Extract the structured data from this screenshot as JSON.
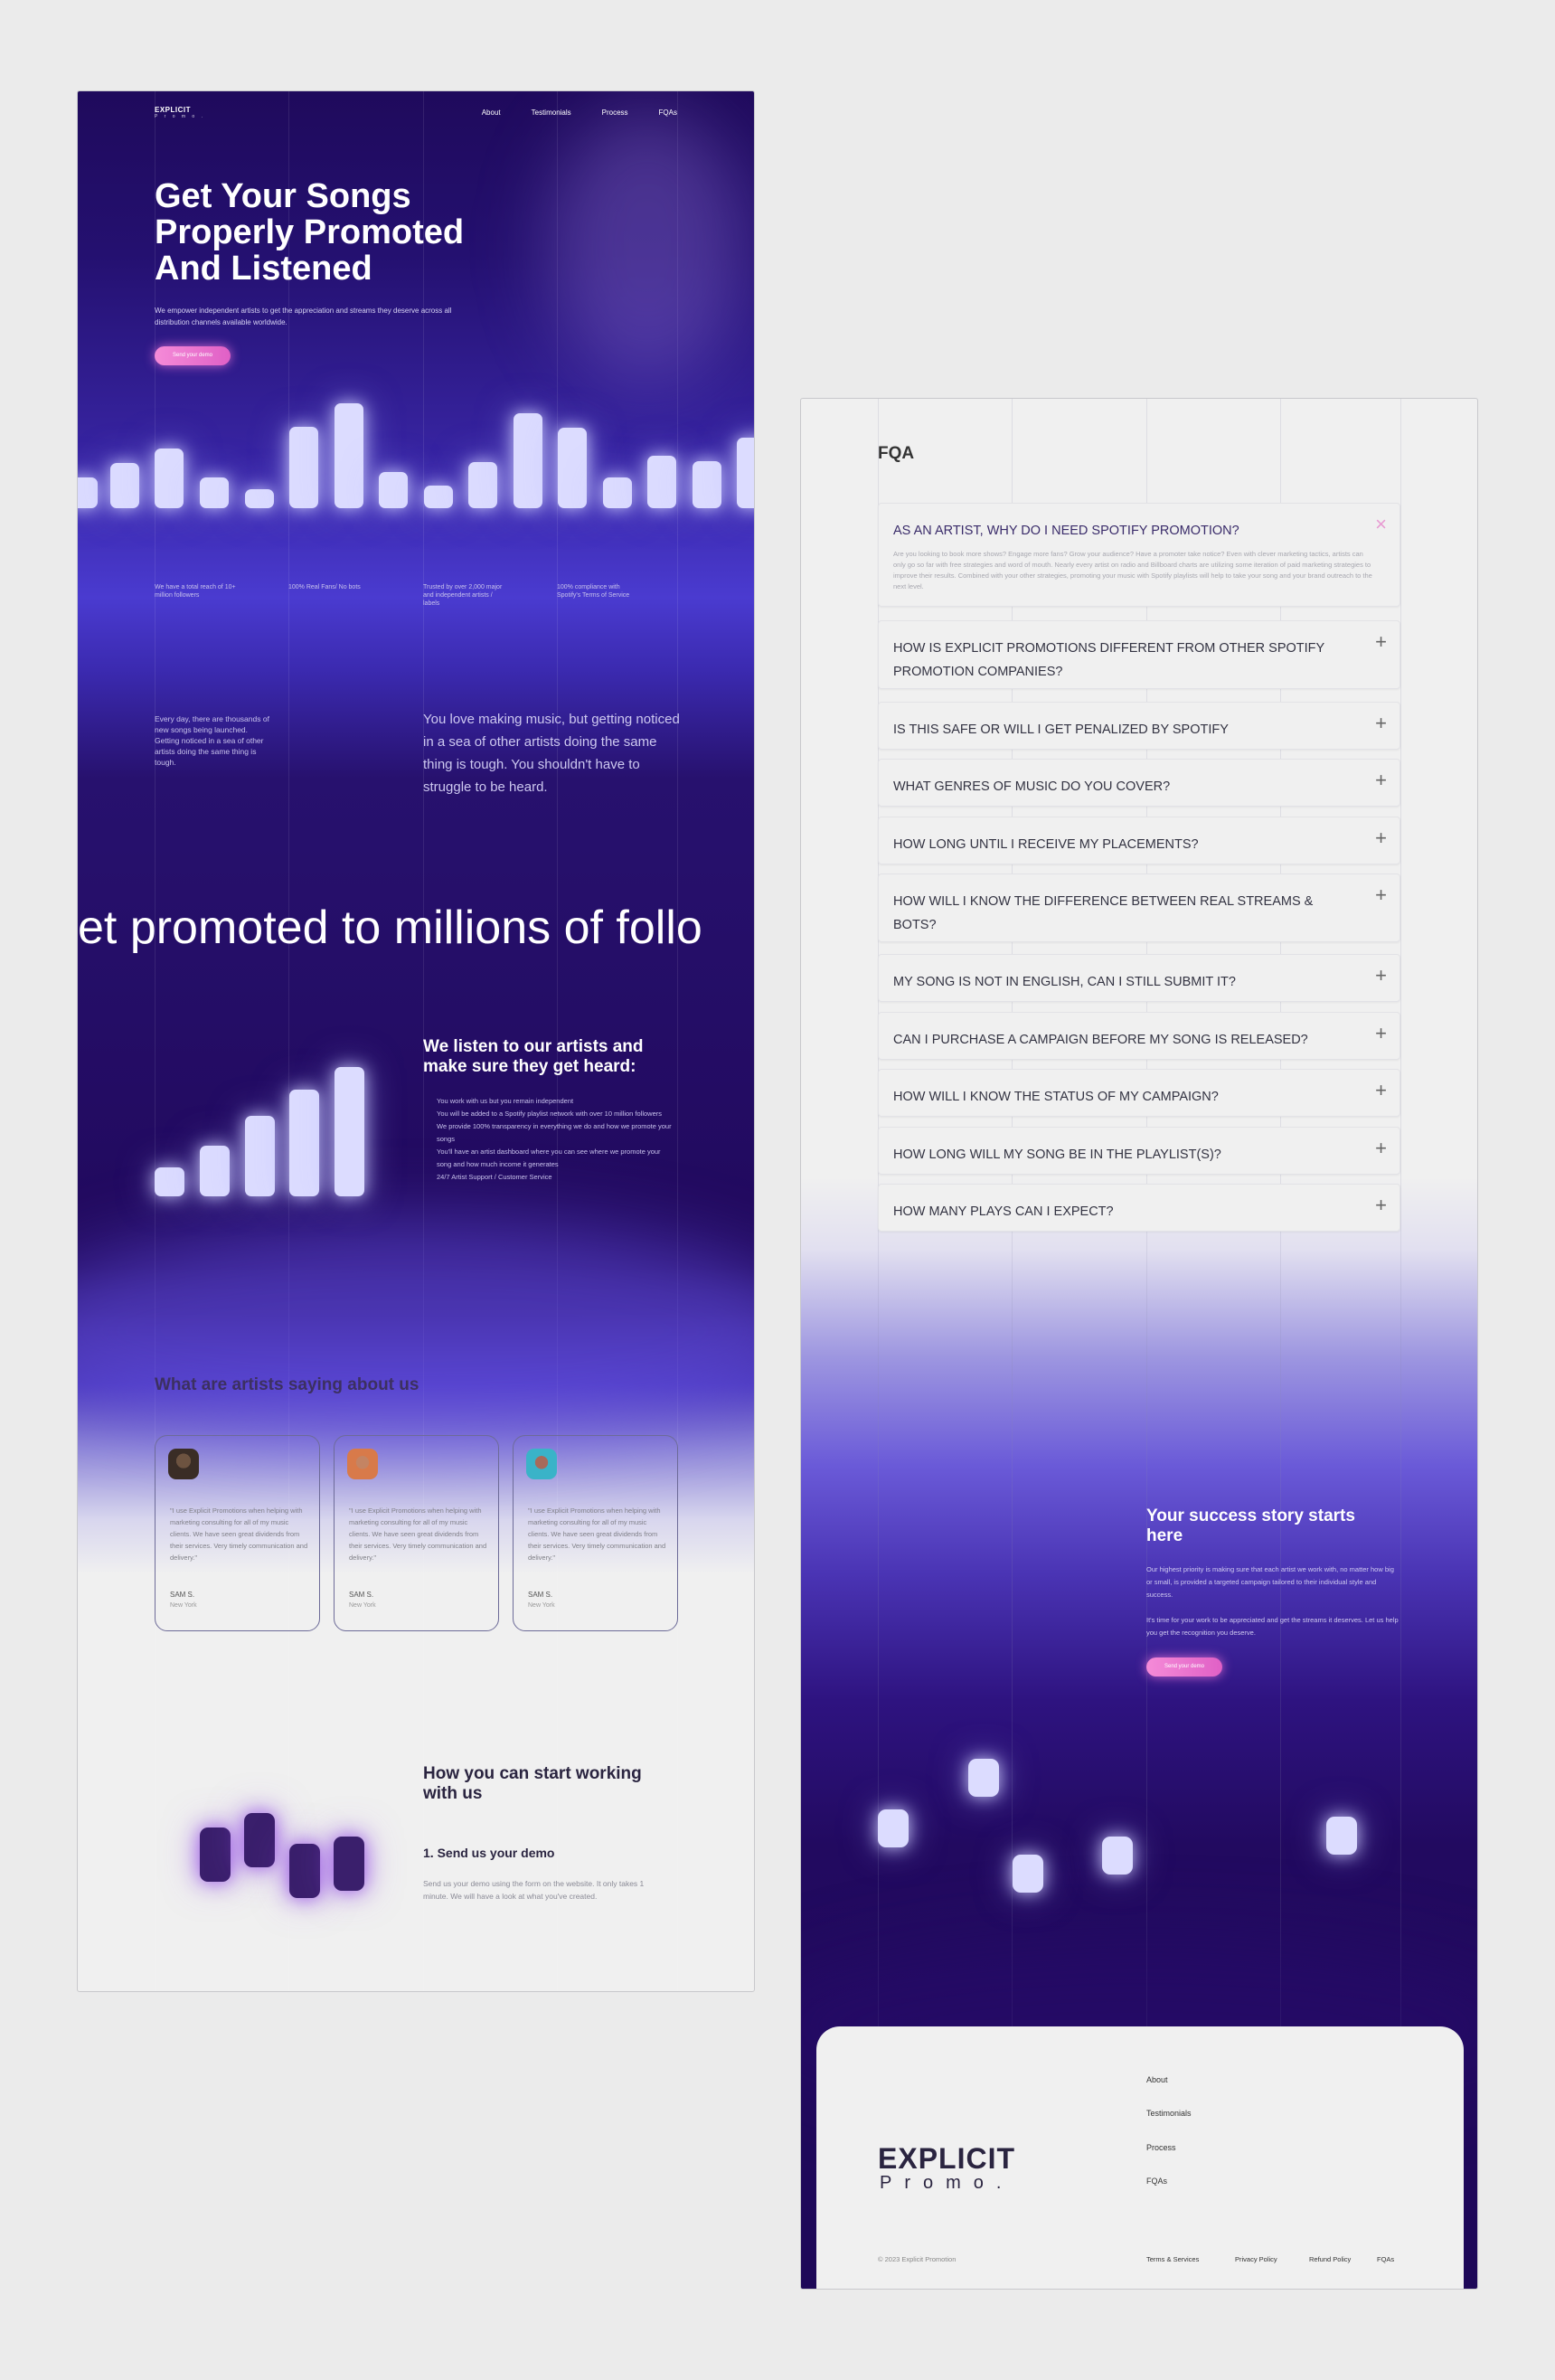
{
  "brand": {
    "name": "EXPLICIT",
    "sub": "Promo.",
    "nav_sub": "P r o m o ."
  },
  "nav": {
    "items": [
      "About",
      "Testimonials",
      "Process",
      "FQAs"
    ]
  },
  "hero": {
    "title": "Get Your Songs Properly Promoted And Listened",
    "subtitle": "We empower independent artists to get the appreciation and streams they deserve across all distribution channels available worldwide.",
    "cta": "Send your demo"
  },
  "stats": [
    "We have a total reach of 10+ million followers",
    "100% Real Fans/ No bots",
    "Trusted by over 2,000 major and independent artists / labels",
    "100% compliance with Spotify's Terms of Service"
  ],
  "intro": {
    "small": "Every day, there are thousands of new songs being launched. Getting noticed in a sea of other artists doing the same thing is tough.",
    "big": "You love making music, but getting noticed in a sea of other artists doing the same thing is tough. You shouldn't have to struggle to be heard."
  },
  "marquee": "et promoted to millions of follo",
  "listen": {
    "title": "We listen to our artists and make sure they get heard:",
    "items": [
      "You work with us but you remain independent",
      "You will be added to a Spotify playlist network with over 10 million followers",
      "We provide 100% transparency in everything we do and how we promote your songs",
      "You'll have an artist dashboard where you can see where we promote your song and how much income it generates",
      "24/7 Artist Support / Customer Service"
    ]
  },
  "testimonials": {
    "title": "What are artists saying about us",
    "cards": [
      {
        "quote": "\"I use Explicit Promotions when helping with marketing consulting for all of my music clients. We have seen great dividends from their services. Very timely communication and delivery.\"",
        "name": "SAM S.",
        "city": "New York"
      },
      {
        "quote": "\"I use Explicit Promotions when helping with marketing consulting for all of my music clients. We have seen great dividends from their services. Very timely communication and delivery.\"",
        "name": "SAM S.",
        "city": "New York"
      },
      {
        "quote": "\"I use Explicit Promotions when helping with marketing consulting for all of my music clients. We have seen great dividends from their services. Very timely communication and delivery.\"",
        "name": "SAM S.",
        "city": "New York"
      }
    ]
  },
  "process": {
    "title": "How you can start working with us",
    "step_title": "1. Send us your demo",
    "step_text": "Send us your demo using the form on the website. It only takes 1 minute. We will have a look at what you've created."
  },
  "faq": {
    "title": "FQA",
    "items": [
      {
        "q": "AS AN ARTIST, WHY DO I NEED SPOTIFY PROMOTION?",
        "a": "Are you looking to book more shows? Engage more fans? Grow your audience? Have a promoter take notice? Even with clever marketing tactics, artists can only go so far with free strategies and word of mouth. Nearly every artist on radio and Billboard charts are utilizing some iteration of paid marketing strategies to improve their results. Combined with your other strategies, promoting your music with Spotify playlists will help to take your song and your brand outreach to the next level.",
        "sign": "×"
      },
      {
        "q": "HOW IS EXPLICIT PROMOTIONS DIFFERENT FROM OTHER SPOTIFY PROMOTION COMPANIES?",
        "sign": "+"
      },
      {
        "q": "IS THIS SAFE OR WILL I GET PENALIZED BY SPOTIFY",
        "sign": "+"
      },
      {
        "q": "WHAT GENRES OF MUSIC DO YOU COVER?",
        "sign": "+"
      },
      {
        "q": "HOW LONG UNTIL I RECEIVE MY PLACEMENTS?",
        "sign": "+"
      },
      {
        "q": "HOW WILL I KNOW THE DIFFERENCE BETWEEN REAL STREAMS & BOTS?",
        "sign": "+"
      },
      {
        "q": "MY SONG IS NOT IN ENGLISH, CAN I STILL SUBMIT IT?",
        "sign": "+"
      },
      {
        "q": "CAN I PURCHASE A CAMPAIGN BEFORE MY SONG IS RELEASED?",
        "sign": "+"
      },
      {
        "q": "HOW WILL I KNOW THE STATUS OF MY CAMPAIGN?",
        "sign": "+"
      },
      {
        "q": "HOW LONG WILL MY SONG BE IN THE PLAYLIST(S)?",
        "sign": "+"
      },
      {
        "q": "HOW MANY PLAYS CAN I EXPECT?",
        "sign": "+"
      }
    ]
  },
  "success": {
    "title": "Your success story starts here",
    "text1": "Our highest priority is making sure that each artist we work with, no matter how big or small, is provided a targeted campaign tailored to their individual style and success.",
    "text2": "It's time for your work to be appreciated and get the streams it deserves. Let us help you get the recognition you deserve.",
    "cta": "Send your demo"
  },
  "footer": {
    "logo": "EXPLICIT",
    "logo_sub": "Promo.",
    "nav": [
      "About",
      "Testimonials",
      "Process",
      "FQAs"
    ],
    "copyright": "© 2023  Explicit Promotion",
    "legal": [
      "Terms &  Services",
      "Privacy Policy",
      "Refund Policy",
      "FQAs"
    ]
  },
  "colors": {
    "accent_pink": "#f07ad6",
    "deep_purple": "#21095d",
    "bar_light": "#dcdcff"
  }
}
